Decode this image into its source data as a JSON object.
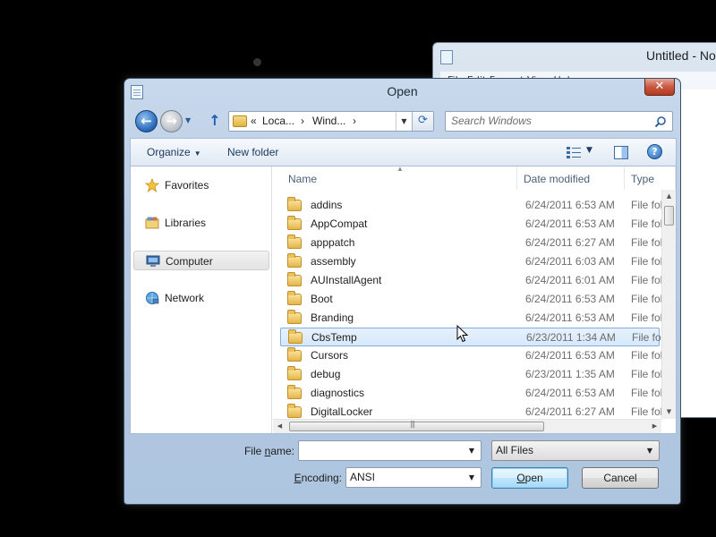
{
  "background_window": {
    "title": "Untitled - No",
    "menu": "File  Edit  Format  View  Help"
  },
  "dialog": {
    "title": "Open",
    "close_label": "✕"
  },
  "nav": {
    "address_segments": [
      "«",
      "Loca...",
      "›",
      "Wind...",
      "›"
    ],
    "search_placeholder": "Search Windows"
  },
  "toolbar": {
    "organize_label": "Organize",
    "new_folder_label": "New folder"
  },
  "nav_pane": {
    "items": [
      {
        "label": "Favorites",
        "icon": "star-icon",
        "selected": false
      },
      {
        "label": "Libraries",
        "icon": "libraries-icon",
        "selected": false
      },
      {
        "label": "Computer",
        "icon": "computer-icon",
        "selected": true
      },
      {
        "label": "Network",
        "icon": "network-icon",
        "selected": false
      }
    ]
  },
  "columns": {
    "name": "Name",
    "date": "Date modified",
    "type": "Type"
  },
  "files": [
    {
      "name": "addins",
      "date": "6/24/2011 6:53 AM",
      "type": "File fol"
    },
    {
      "name": "AppCompat",
      "date": "6/24/2011 6:53 AM",
      "type": "File fol"
    },
    {
      "name": "apppatch",
      "date": "6/24/2011 6:27 AM",
      "type": "File fol"
    },
    {
      "name": "assembly",
      "date": "6/24/2011 6:03 AM",
      "type": "File fol"
    },
    {
      "name": "AUInstallAgent",
      "date": "6/24/2011 6:01 AM",
      "type": "File fol"
    },
    {
      "name": "Boot",
      "date": "6/24/2011 6:53 AM",
      "type": "File fol"
    },
    {
      "name": "Branding",
      "date": "6/24/2011 6:53 AM",
      "type": "File fol"
    },
    {
      "name": "CbsTemp",
      "date": "6/23/2011 1:34 AM",
      "type": "File fol"
    },
    {
      "name": "Cursors",
      "date": "6/24/2011 6:53 AM",
      "type": "File fol"
    },
    {
      "name": "debug",
      "date": "6/23/2011 1:35 AM",
      "type": "File fol"
    },
    {
      "name": "diagnostics",
      "date": "6/24/2011 6:53 AM",
      "type": "File fol"
    },
    {
      "name": "DigitalLocker",
      "date": "6/24/2011 6:27 AM",
      "type": "File fol"
    }
  ],
  "hovered_file": "CbsTemp",
  "form": {
    "file_name_label_pre": "File ",
    "file_name_label_u": "n",
    "file_name_label_post": "ame:",
    "file_name_value": "",
    "filter_value": "All Files",
    "encoding_label_pre": "",
    "encoding_label_u": "E",
    "encoding_label_post": "ncoding:",
    "encoding_value": "ANSI",
    "open_label_u": "O",
    "open_label_post": "pen",
    "cancel_label": "Cancel"
  }
}
